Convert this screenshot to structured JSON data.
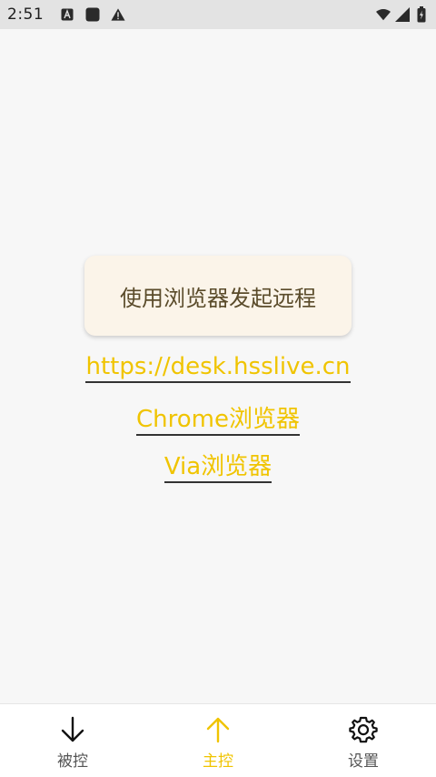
{
  "status_bar": {
    "time": "2:51",
    "icons": [
      "a-notification-icon",
      "square-notification-icon",
      "warning-icon",
      "wifi-icon",
      "signal-icon",
      "battery-icon"
    ]
  },
  "main": {
    "action_button_label": "使用浏览器发起远程",
    "links": {
      "url": "https://desk.hsslive.cn",
      "chrome": "Chrome浏览器",
      "via": "Via浏览器"
    }
  },
  "bottom_nav": {
    "items": [
      {
        "label": "被控",
        "icon": "arrow-down-icon",
        "active": false
      },
      {
        "label": "主控",
        "icon": "arrow-up-icon",
        "active": true
      },
      {
        "label": "设置",
        "icon": "gear-icon",
        "active": false
      }
    ]
  },
  "colors": {
    "accent": "#f0c400",
    "card_bg": "#fbf4e9",
    "page_bg": "#f7f7f7",
    "status_bar_bg": "#e3e3e3"
  }
}
